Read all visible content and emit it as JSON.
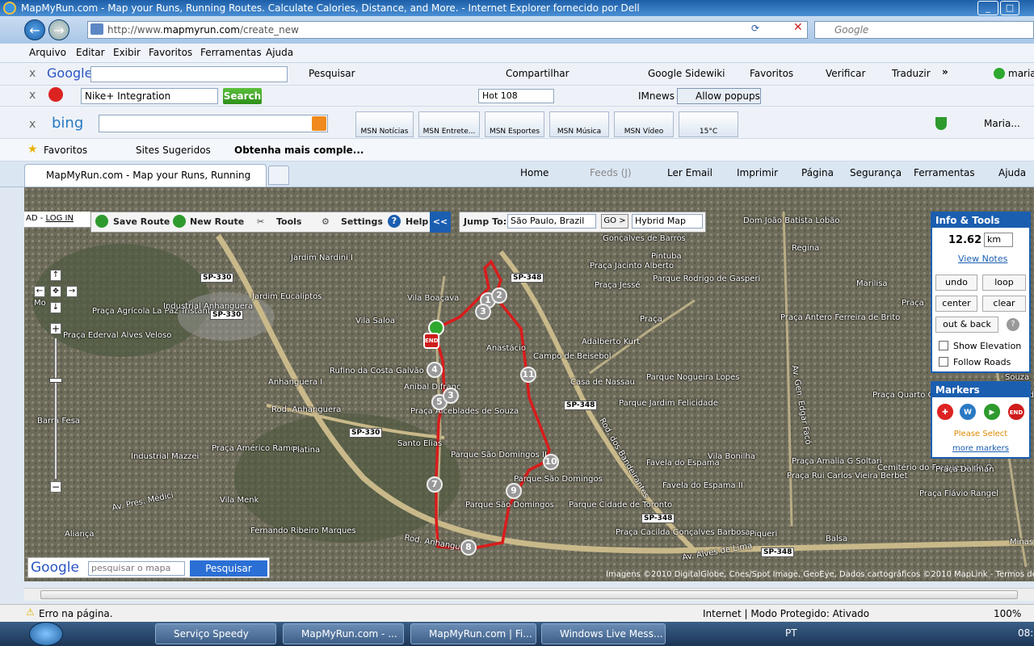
{
  "window": {
    "title": "MapMyRun.com - Map your Runs, Running Routes. Calculate Calories, Distance, and More. - Internet Explorer fornecido por Dell"
  },
  "nav": {
    "url_prefix": "http://www.",
    "url_domain": "mapmyrun.com",
    "url_path": "/create_new",
    "search_placeholder": "Google"
  },
  "menu": [
    "Arquivo",
    "Editar",
    "Exibir",
    "Favoritos",
    "Ferramentas",
    "Ajuda"
  ],
  "google_toolbar": {
    "logo": "Google",
    "search": "Pesquisar",
    "share": "Compartilhar",
    "sidewiki": "Google Sidewiki",
    "favorites": "Favoritos",
    "check": "Verificar",
    "translate": "Traduzir",
    "more": "»",
    "user": "marian"
  },
  "nike_toolbar": {
    "select": "Nike+ Integration",
    "search": "Search",
    "radio": "Hot 108",
    "news": "IMnews",
    "popups": "Allow popups"
  },
  "bing_toolbar": {
    "logo": "bing",
    "items": [
      "MSN Notícias",
      "MSN Entrete...",
      "MSN Esportes",
      "MSN Música",
      "MSN Vídeo",
      "15°C"
    ],
    "user": "Maria..."
  },
  "favbar": {
    "favorites": "Favoritos",
    "suggested": "Sites Sugeridos",
    "more": "Obtenha mais comple..."
  },
  "tab": {
    "title": "MapMyRun.com - Map your Runs, Running Rout..."
  },
  "cmdbar": {
    "home": "Home",
    "feeds": "Feeds (J)",
    "email": "Ler Email",
    "print": "Imprimir",
    "page": "Página",
    "security": "Segurança",
    "tools": "Ferramentas",
    "help": "Ajuda"
  },
  "map_toolbar": {
    "login_prefix": "AD -",
    "login": "LOG IN",
    "save": "Save Route",
    "new": "New Route",
    "tools": "Tools",
    "settings": "Settings",
    "help": "Help",
    "collapse": "<<",
    "jump_label": "Jump To:",
    "jump_value": "São Paulo, Brazil",
    "go": "GO >",
    "maptype": "Hybrid Map"
  },
  "info": {
    "title": "Info & Tools",
    "distance": "12.62",
    "unit": "km",
    "notes": "View Notes",
    "undo": "undo",
    "loop": "loop",
    "center": "center",
    "clear": "clear",
    "outback": "out & back",
    "elevation": "Show Elevation",
    "follow": "Follow Roads"
  },
  "markers": {
    "title": "Markers",
    "select": "Please Select",
    "more": "more markers"
  },
  "google_map": {
    "logo": "Google",
    "placeholder": "pesquisar o mapa",
    "button": "Pesquisar",
    "credits": "Imagens ©2010 DigitalGlobe, Cnes/Spot Image, GeoEye, Dados cartográficos ©2010 MapLink - Termos de Uso"
  },
  "route_markers": [
    "1",
    "2",
    "3",
    "4",
    "5",
    "3",
    "7",
    "8",
    "9",
    "10",
    "11"
  ],
  "map_labels": {
    "l1": "Jardim Nardini I",
    "l2": "Jardim Eucaliptos",
    "l3": "Vila Boaçava",
    "l4": "Vila Saloa",
    "l5": "Praça Agrícola La Paz Tristante",
    "l6": "Industrial Anhanguera",
    "l7": "Praça Ederval Alves Veloso",
    "l8": "Rufino da Costa Galvão",
    "l9": "Anhanguera I",
    "l10": "Rod. Anhanguera",
    "l11": "Anastácio",
    "l12": "Campo de Beisebol",
    "l13": "Casa de Nassau",
    "l14": "Adalberto Kurt",
    "l15": "Parque Nogueira Lopes",
    "l16": "Parque Jardim Felicidade",
    "l17": "Gonçalves de Barros",
    "l18": "Pintuba",
    "l19": "Praça Jacinto Alberto",
    "l20": "Praça Jessé",
    "l21": "Parque Rodrigo de Gasperi",
    "l22": "Dom João Batista Lobão",
    "l23": "Regina",
    "l24": "Marilisa",
    "l25": "Praça Antero Ferreira de Brito",
    "l26": "Aníbal Difranc",
    "l27": "Praça Alceblades de Souza",
    "l28": "Santo Elias",
    "l29": "Parque São Domingos II",
    "l30": "Parque São Domingos",
    "l31": "Parque São Domingos",
    "l32": "Parque Cidade de Toronto",
    "l33": "Praça Cacilda Gonçalves Barbosa",
    "l34": "Favela do Espama",
    "l35": "Favela do Espama II",
    "l36": "Vila Bonilha",
    "l37": "Praça Amalia G Soltari",
    "l38": "Praça Rui Carlos Vieira Berbet",
    "l39": "Cemitério do Freguesia do Ó",
    "l40": "Praça Quarto Centenário da Freguesia do Ó",
    "l41": "Praça Flávio Rangel",
    "l42": "Piqueri",
    "l43": "Balsa",
    "l44": "Minas",
    "l45": "Industrial Mazzei",
    "l46": "Praça Américo Ramos",
    "l47": "Platina",
    "l48": "Vila Menk",
    "l49": "Fernando Ribeiro Marques",
    "l50": "Aliança",
    "l51": "Av. Pres. Médici",
    "l52": "Rod. Anhanguera",
    "l53": "Av. Alves de Lima",
    "l54": "Rod. dos Bandeirantes",
    "l55": "Av. Gen. Edgar Facó",
    "l56": "Barra Fesa",
    "l57": "Mo",
    "l58": "Praça",
    "l59": "Praça",
    "l60": "Souza",
    "l61": "Praça Dollman",
    "h1": "SP-330",
    "h2": "SP-330",
    "h3": "SP-330",
    "h4": "SP-348",
    "h5": "SP-348",
    "h6": "SP-348",
    "h7": "SP-348"
  },
  "status": {
    "error": "Erro na página.",
    "zone": "Internet | Modo Protegido: Ativado",
    "zoom": "100%"
  },
  "taskbar": {
    "items": [
      "Serviço Speedy",
      "MapMyRun.com - ...",
      "MapMyRun.com | Fi...",
      "Windows Live Mess..."
    ],
    "lang": "PT",
    "clock": "08:"
  },
  "colors": {
    "route": "#d91c1c",
    "panel": "#1b5eb0"
  }
}
